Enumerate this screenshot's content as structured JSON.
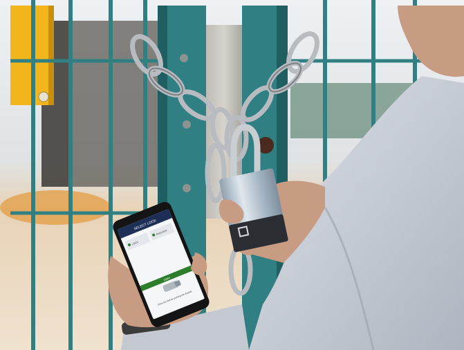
{
  "photo": {
    "subject": "Person unlocking a chained gate padlock with a smartphone app",
    "colors": {
      "gate": "#2f7f83",
      "gate_dark": "#1f5f62",
      "chain": "#b8bcc0",
      "padlock_body": "#b9c6d2",
      "padlock_base": "#2a2e33",
      "yellow_box": "#f2b51c",
      "shirt": "#c9ced6",
      "skin": "#c89b83",
      "sky": "#eef1f3",
      "ground": "#e8d3b7",
      "phone_header": "#1e2f57",
      "phone_green": "#2d7d2a"
    }
  },
  "phone_screen": {
    "header_label": "SELECT LOCK",
    "row_left": "LOCK",
    "row_right": "PADLOCK",
    "status_bar": "Open",
    "footer_text": "Close the lock by pushing the shackle"
  }
}
